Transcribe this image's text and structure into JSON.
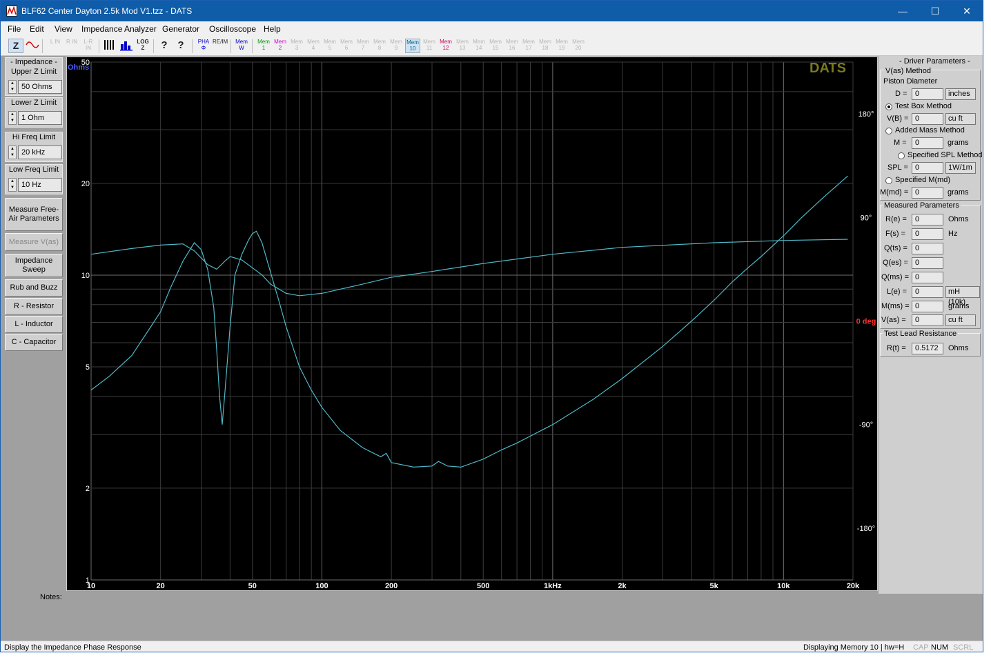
{
  "window": {
    "title": "BLF62 Center Dayton 2.5k Mod V1.tzz - DATS",
    "controls": {
      "minimize": "—",
      "maximize": "☐",
      "close": "✕"
    }
  },
  "menu": [
    "File",
    "Edit",
    "View",
    "Impedance Analyzer",
    "Generator",
    "Oscilloscope",
    "Help"
  ],
  "toolbar": {
    "z": "Z",
    "l_in": "L IN",
    "r_in": "R IN",
    "lr_in": "L-R IN",
    "log": "LOG Z",
    "help": "?",
    "context_help": "?",
    "pha": "PHA Φ",
    "re_im": "RE/IM",
    "mem_w": "Mem W",
    "mems": [
      "Mem 1",
      "Mem 2",
      "Mem 3",
      "Mem 4",
      "Mem 5",
      "Mem 6",
      "Mem 7",
      "Mem 8",
      "Mem 9",
      "Mem 10",
      "Mem 11",
      "Mem 12",
      "Mem 13",
      "Mem 14",
      "Mem 15",
      "Mem 16",
      "Mem 17",
      "Mem 18",
      "Mem 19",
      "Mem 20"
    ]
  },
  "left": {
    "impedance_header": "- Impedance -",
    "upper_z_label": "Upper Z Limit",
    "upper_z_value": "50 Ohms",
    "lower_z_label": "Lower Z Limit",
    "lower_z_value": "1 Ohm",
    "hi_freq_label": "Hi Freq Limit",
    "hi_freq_value": "20 kHz",
    "low_freq_label": "Low Freq Limit",
    "low_freq_value": "10 Hz",
    "buttons": {
      "measure_free_air": "Measure Free-Air Parameters",
      "measure_vas": "Measure V(as)",
      "impedance_sweep": "Impedance Sweep",
      "rub_buzz": "Rub and Buzz",
      "resistor": "R - Resistor",
      "inductor": "L - Inductor",
      "capacitor": "C - Capacitor"
    }
  },
  "right": {
    "header": "- Driver Parameters -",
    "vas_method": "V(as) Method",
    "piston_diameter": "Piston Diameter",
    "d_label": "D =",
    "d_value": "0",
    "d_unit": "inches",
    "test_box": "Test Box Method",
    "vb_label": "V(B) =",
    "vb_value": "0",
    "vb_unit": "cu ft",
    "added_mass": "Added Mass Method",
    "m_label": "M =",
    "m_value": "0",
    "m_unit": "grams",
    "spl_method": "Specified SPL Method",
    "spl_label": "SPL =",
    "spl_value": "0",
    "spl_unit": "1W/1m",
    "mmd_method": "Specified M(md)",
    "mmd_label": "M(md) =",
    "mmd_value": "0",
    "mmd_unit": "grams",
    "measured": "Measured Parameters",
    "re_label": "R(e) =",
    "re_value": "0",
    "re_unit": "Ohms",
    "fs_label": "F(s) =",
    "fs_value": "0",
    "fs_unit": "Hz",
    "qts_label": "Q(ts) =",
    "qts_value": "0",
    "qes_label": "Q(es) =",
    "qes_value": "0",
    "qms_label": "Q(ms) =",
    "qms_value": "0",
    "le_label": "L(e) =",
    "le_value": "0",
    "le_unit": "mH (10k)",
    "mms_label": "M(ms) =",
    "mms_value": "0",
    "mms_unit": "grams",
    "vas_label": "V(as) =",
    "vas_value": "0",
    "vas_unit": "cu ft",
    "test_lead": "Test Lead Resistance",
    "rt_label": "R(t) =",
    "rt_value": "0.5172",
    "rt_unit": "Ohms"
  },
  "notes_label": "Notes:",
  "status": {
    "left": "Display the Impedance Phase Response",
    "memory": "Displaying Memory 10 | hw=H",
    "cap": "CAP",
    "num": "NUM",
    "scrl": "SCRL"
  },
  "chart_data": {
    "type": "line",
    "watermark": "DATS",
    "ylabel": "Ohms",
    "y2label": "0 deg",
    "xscale": "log",
    "yscale": "log",
    "xlim": [
      10,
      20000
    ],
    "ylim": [
      1,
      50
    ],
    "y2lim": [
      -180,
      180
    ],
    "x_ticks": [
      {
        "v": 10,
        "label": "10"
      },
      {
        "v": 20,
        "label": "20"
      },
      {
        "v": 50,
        "label": "50"
      },
      {
        "v": 100,
        "label": "100"
      },
      {
        "v": 200,
        "label": "200"
      },
      {
        "v": 500,
        "label": "500"
      },
      {
        "v": 1000,
        "label": "1kHz"
      },
      {
        "v": 2000,
        "label": "2k"
      },
      {
        "v": 5000,
        "label": "5k"
      },
      {
        "v": 10000,
        "label": "10k"
      },
      {
        "v": 20000,
        "label": "20k"
      }
    ],
    "y_ticks": [
      {
        "v": 50,
        "label": "50"
      },
      {
        "v": 20,
        "label": "20"
      },
      {
        "v": 10,
        "label": "10"
      },
      {
        "v": 5,
        "label": "5"
      },
      {
        "v": 2,
        "label": "2"
      },
      {
        "v": 1,
        "label": "1"
      }
    ],
    "y2_ticks": [
      {
        "v": 180,
        "label": "180°"
      },
      {
        "v": 90,
        "label": "90°"
      },
      {
        "v": -90,
        "label": "-90°"
      },
      {
        "v": -180,
        "label": "-180°"
      }
    ],
    "grid": true,
    "color": "#4fb8c8",
    "series": [
      {
        "axis": "phase",
        "points": [
          [
            10,
            -60
          ],
          [
            12,
            -48
          ],
          [
            15,
            -30
          ],
          [
            18,
            -6
          ],
          [
            20,
            8
          ],
          [
            22,
            28
          ],
          [
            25,
            52
          ],
          [
            28,
            68
          ],
          [
            30,
            62
          ],
          [
            32,
            45
          ],
          [
            34,
            12
          ],
          [
            35,
            -25
          ],
          [
            36,
            -65
          ],
          [
            37,
            -90
          ],
          [
            38,
            -62
          ],
          [
            40,
            -5
          ],
          [
            42,
            40
          ],
          [
            45,
            58
          ],
          [
            48,
            70
          ],
          [
            50,
            76
          ],
          [
            52,
            78
          ],
          [
            55,
            68
          ],
          [
            60,
            42
          ],
          [
            65,
            18
          ],
          [
            70,
            -5
          ],
          [
            80,
            -40
          ],
          [
            90,
            -60
          ],
          [
            100,
            -75
          ],
          [
            120,
            -95
          ],
          [
            150,
            -110
          ],
          [
            180,
            -118
          ],
          [
            190,
            -115
          ],
          [
            200,
            -123
          ],
          [
            250,
            -127
          ],
          [
            300,
            -126
          ],
          [
            320,
            -122
          ],
          [
            350,
            -126
          ],
          [
            400,
            -127
          ],
          [
            500,
            -120
          ],
          [
            600,
            -112
          ],
          [
            700,
            -106
          ],
          [
            1000,
            -90
          ],
          [
            1500,
            -68
          ],
          [
            2000,
            -50
          ],
          [
            3000,
            -22
          ],
          [
            4000,
            0
          ],
          [
            5000,
            18
          ],
          [
            6000,
            34
          ],
          [
            7000,
            46
          ],
          [
            8000,
            56
          ],
          [
            10000,
            74
          ],
          [
            12000,
            90
          ],
          [
            15000,
            108
          ],
          [
            19000,
            126
          ]
        ]
      },
      {
        "axis": "phase",
        "points": [
          [
            10,
            58
          ],
          [
            15,
            63
          ],
          [
            20,
            66
          ],
          [
            25,
            67
          ],
          [
            28,
            61
          ],
          [
            32,
            49
          ],
          [
            35,
            45
          ],
          [
            38,
            52
          ],
          [
            40,
            56
          ],
          [
            45,
            53
          ],
          [
            55,
            40
          ],
          [
            60,
            32
          ],
          [
            70,
            24
          ],
          [
            80,
            22
          ],
          [
            100,
            24
          ],
          [
            150,
            32
          ],
          [
            200,
            38
          ],
          [
            300,
            43
          ],
          [
            500,
            50
          ],
          [
            1000,
            58
          ],
          [
            2000,
            64
          ],
          [
            5000,
            68
          ],
          [
            10000,
            70
          ],
          [
            19000,
            71
          ]
        ]
      }
    ]
  }
}
